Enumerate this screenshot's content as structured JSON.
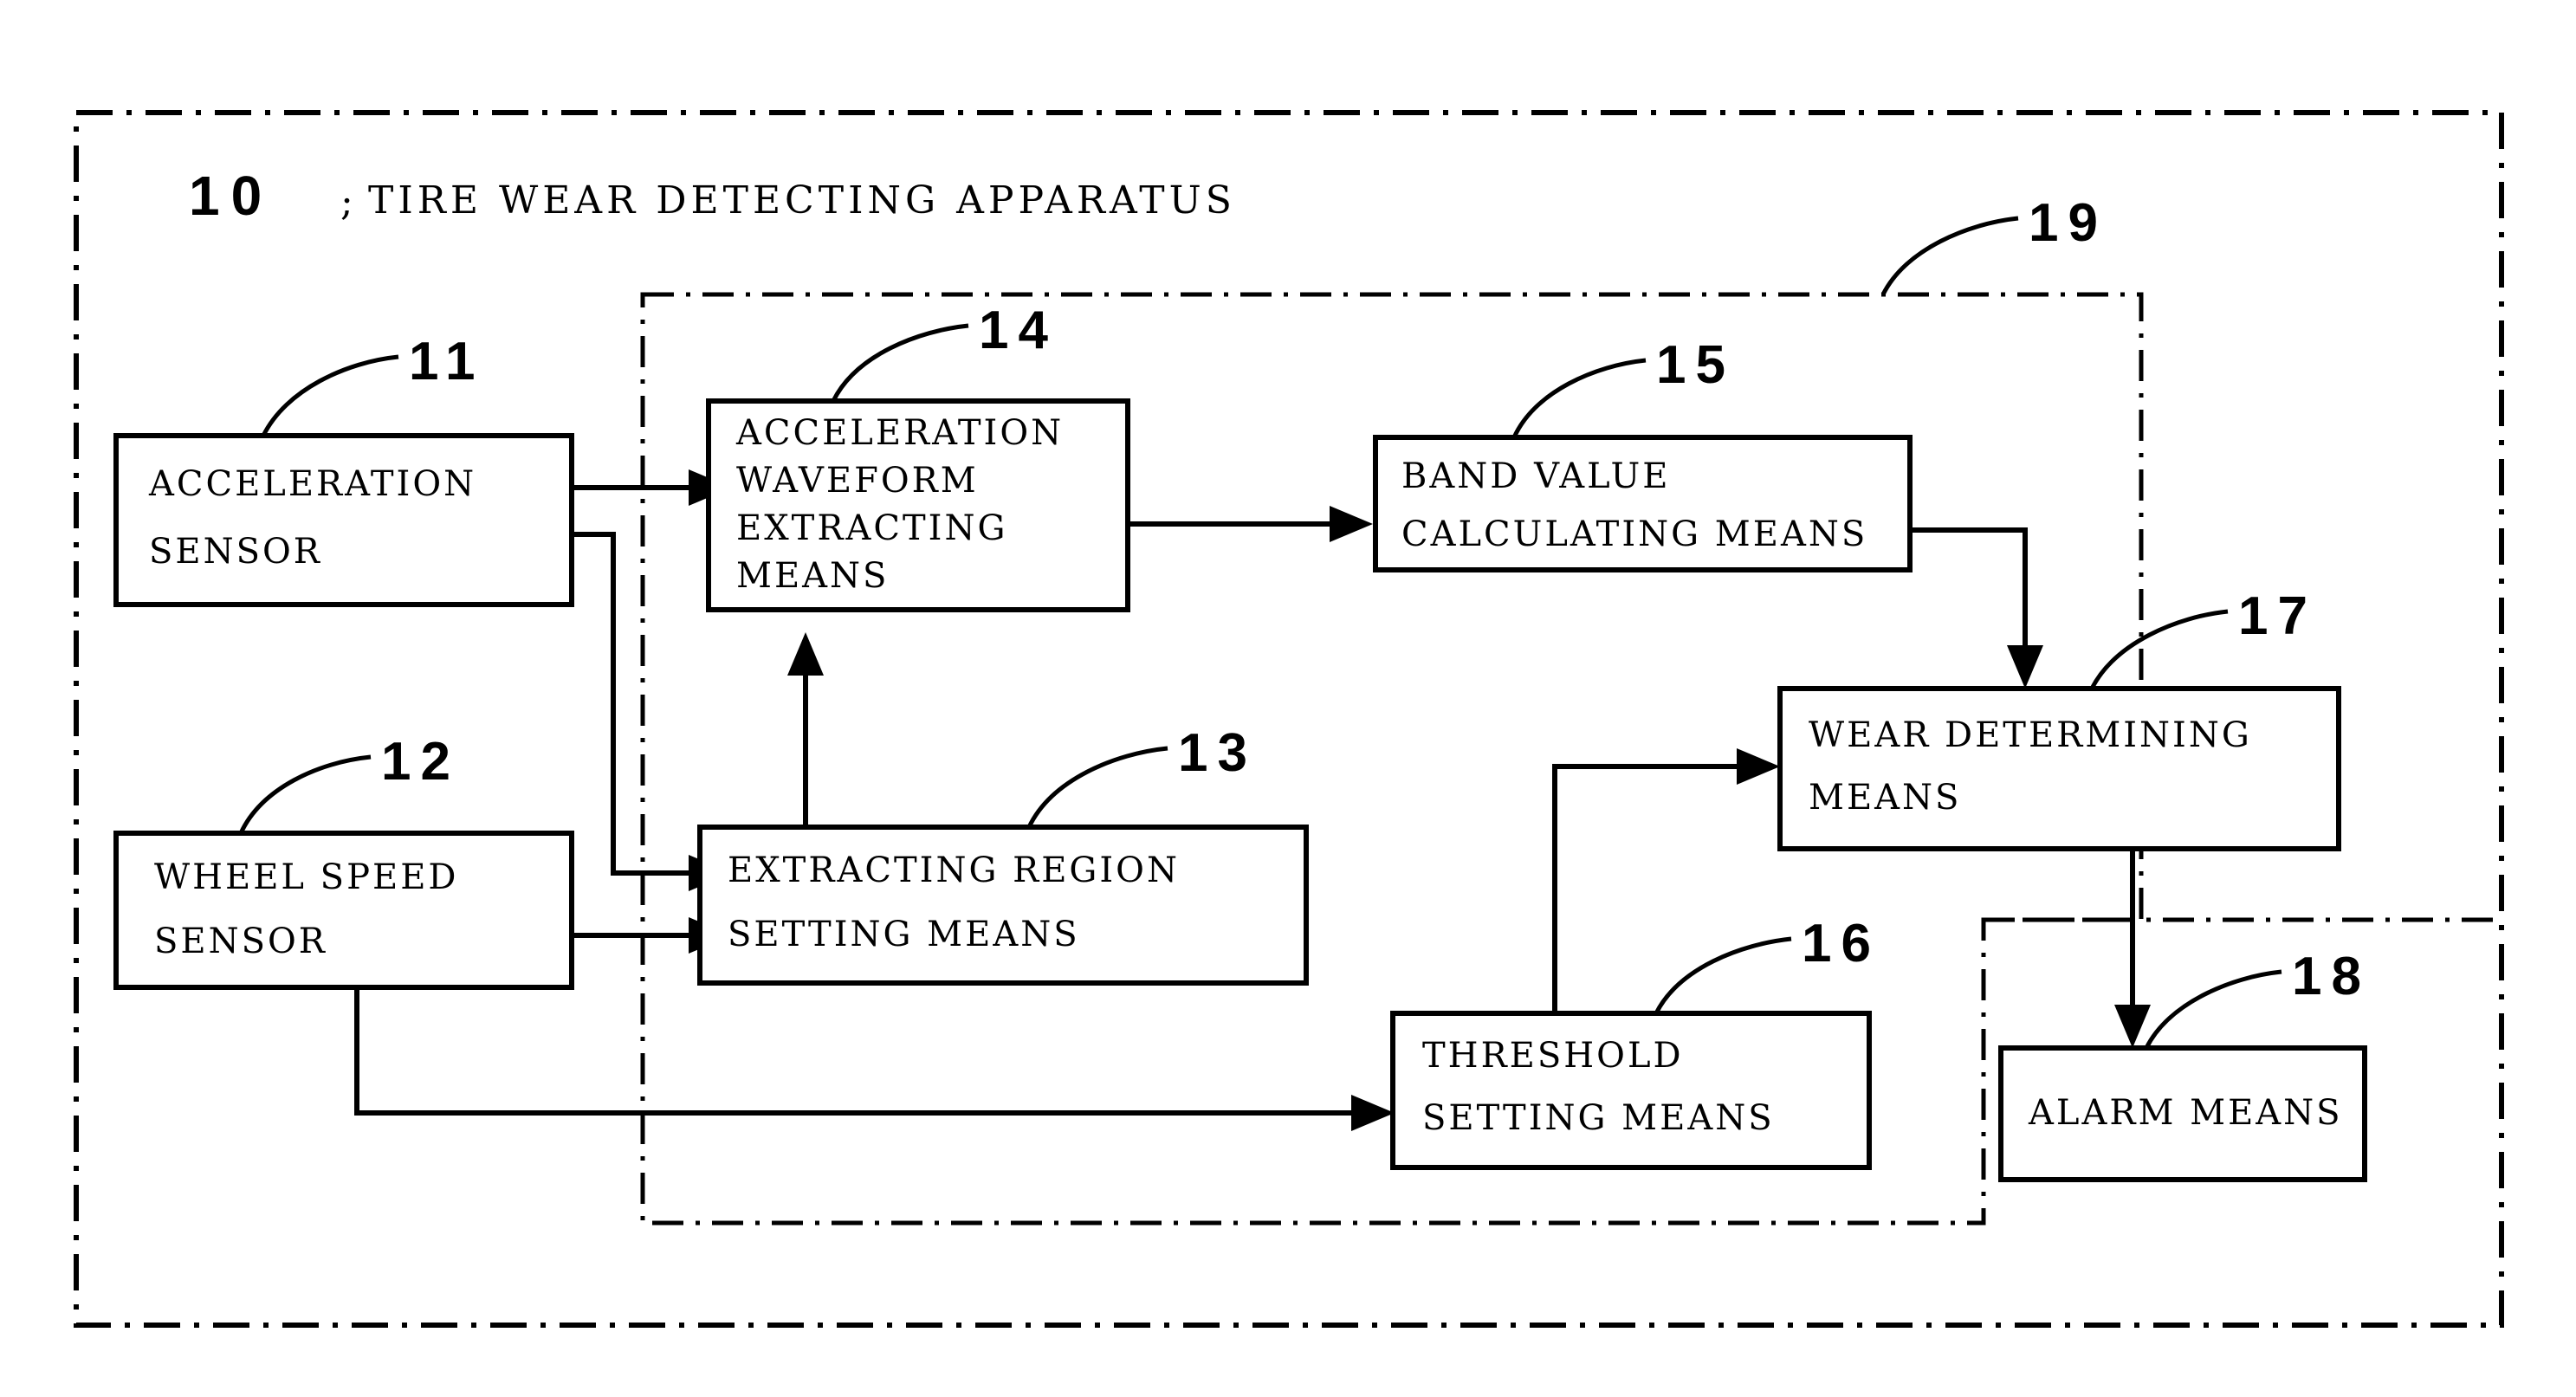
{
  "figure": {
    "title": {
      "number": "10",
      "separator": ";",
      "text": "TIRE WEAR DETECTING APPARATUS"
    },
    "outer_frame_label": "10",
    "inner_frame_label": "19",
    "blocks": [
      {
        "ref": "11",
        "name": "acceleration-sensor",
        "lines": [
          "ACCELERATION",
          "SENSOR"
        ]
      },
      {
        "ref": "12",
        "name": "wheel-speed-sensor",
        "lines": [
          "WHEEL SPEED",
          "SENSOR"
        ]
      },
      {
        "ref": "13",
        "name": "extracting-region-setting-means",
        "lines": [
          "EXTRACTING REGION",
          "SETTING MEANS"
        ]
      },
      {
        "ref": "14",
        "name": "acceleration-waveform-extracting-means",
        "lines": [
          "ACCELERATION",
          "WAVEFORM",
          "EXTRACTING",
          "MEANS"
        ]
      },
      {
        "ref": "15",
        "name": "band-value-calculating-means",
        "lines": [
          "BAND VALUE",
          "CALCULATING MEANS"
        ]
      },
      {
        "ref": "16",
        "name": "threshold-setting-means",
        "lines": [
          "THRESHOLD",
          "SETTING MEANS"
        ]
      },
      {
        "ref": "17",
        "name": "wear-determining-means",
        "lines": [
          "WEAR DETERMINING",
          "MEANS"
        ]
      },
      {
        "ref": "18",
        "name": "alarm-means",
        "lines": [
          "ALARM MEANS"
        ]
      }
    ],
    "colors": {
      "ink": "#000000",
      "paper": "#ffffff"
    }
  }
}
